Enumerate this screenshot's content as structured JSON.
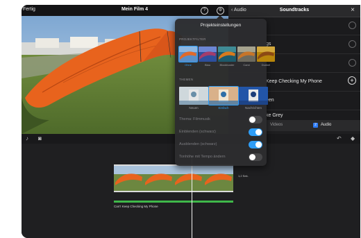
{
  "top_bar": {
    "done_label": "Fertig",
    "title": "Mein Film 4",
    "help_icon": "question-circle-icon",
    "settings_icon": "gear-icon"
  },
  "soundtracks_panel": {
    "back_label": "Audio",
    "title": "Soundtracks",
    "close_icon": "close-icon",
    "rows": [
      {
        "label": "",
        "action_icon": "download-icon"
      },
      {
        "label": "gs",
        "action_icon": "download-icon"
      },
      {
        "label": "",
        "action_icon": "download-icon"
      },
      {
        "label": "Keep Checking My Phone",
        "action_icon": "add-circle-icon"
      },
      {
        "label": "een",
        "action_icon": ""
      },
      {
        "label": "ke Grey",
        "action_icon": ""
      }
    ],
    "tabs": {
      "left_label": "Videos",
      "audio_label": "Audio",
      "audio_badge": "2"
    }
  },
  "project_settings": {
    "title": "Projekteinstellungen",
    "filters_section": "PROJEKTFILTER",
    "filters": [
      {
        "label": "Ohne",
        "selected": true,
        "colors": [
          "#5a8fc9",
          "#8db7e2",
          "#e16a2b"
        ]
      },
      {
        "label": "Blau",
        "selected": false,
        "colors": [
          "#2d4f9e",
          "#6c86d4",
          "#a33c6b"
        ]
      },
      {
        "label": "Blockbuster",
        "selected": false,
        "colors": [
          "#1d5a6b",
          "#3f8b95",
          "#d77a1e"
        ]
      },
      {
        "label": "Cami",
        "selected": false,
        "colors": [
          "#6d6a5e",
          "#a6a38e",
          "#c7752a"
        ]
      },
      {
        "label": "Dunkel",
        "selected": false,
        "colors": [
          "#b8860b",
          "#d4a93c",
          "#8c4a14"
        ]
      }
    ],
    "themes_section": "THEMEN",
    "themes": [
      {
        "label": "Neuen",
        "selected": false,
        "colors": [
          "#cfd8dc",
          "#6a8fa8",
          "#e6e6e6"
        ]
      },
      {
        "label": "Einfach",
        "selected": true,
        "colors": [
          "#d9b18a",
          "#2f6fa8",
          "#f2e6d2"
        ]
      },
      {
        "label": "Nachrichten",
        "selected": false,
        "colors": [
          "#2255a8",
          "#1b3d7a",
          "#e8e8e8"
        ]
      }
    ],
    "settings": [
      {
        "label": "Thema: Filmmusik",
        "on": false
      },
      {
        "label": "Einblenden (schwarz)",
        "on": true
      },
      {
        "label": "Ausblenden (schwarz)",
        "on": true
      },
      {
        "label": "Tonhöhe mit Tempo ändern",
        "on": false
      }
    ]
  },
  "timeline": {
    "mic_icon": "microphone-icon",
    "camera_icon": "camera-icon",
    "undo_icon": "undo-icon",
    "marker_icon": "diamond-icon",
    "clip_duration": "1,2 Sek.",
    "audio_track_label": "Can't Keep Checking My Phone"
  },
  "colors": {
    "accent": "#2e9df6",
    "audio_track": "#3fb84a",
    "kite_orange": "#e8631d"
  }
}
